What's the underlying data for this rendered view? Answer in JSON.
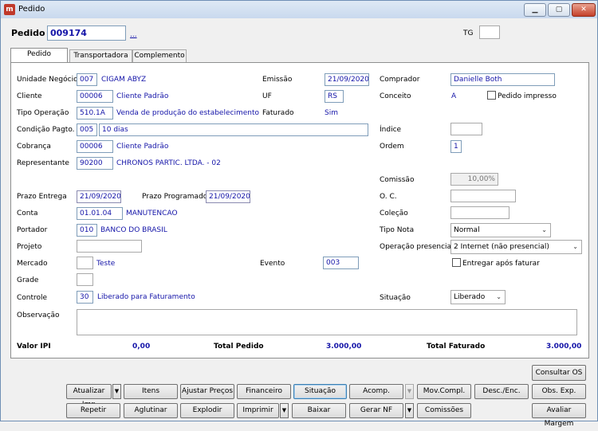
{
  "window": {
    "title": "Pedido",
    "min": "▁",
    "max": "▢",
    "close": "✕"
  },
  "header": {
    "pedido_label": "Pedido",
    "pedido_number": "009174",
    "lookup": "...",
    "tg_label": "TG",
    "tg_value": ""
  },
  "tabs": [
    {
      "label": "Pedido"
    },
    {
      "label": "Transportadora"
    },
    {
      "label": "Complemento"
    }
  ],
  "form": {
    "unidade": {
      "label": "Unidade Negócio",
      "code": "007",
      "name": "CIGAM ABYZ"
    },
    "emissao": {
      "label": "Emissão",
      "value": "21/09/2020"
    },
    "comprador": {
      "label": "Comprador",
      "value": "Danielle Both"
    },
    "cliente": {
      "label": "Cliente",
      "code": "00006",
      "name": "Cliente Padrão"
    },
    "uf": {
      "label": "UF",
      "value": "RS"
    },
    "conceito": {
      "label": "Conceito",
      "value": "A"
    },
    "pedido_impresso": {
      "label": "Pedido impresso"
    },
    "tipo_operacao": {
      "label": "Tipo Operação",
      "code": "510.1A",
      "name": "Venda de produção do estabelecimento"
    },
    "faturado": {
      "label": "Faturado",
      "value": "Sim"
    },
    "condicao": {
      "label": "Condição Pagto.",
      "code": "005",
      "name": "10 dias"
    },
    "indice": {
      "label": "Índice",
      "value": ""
    },
    "cobranca": {
      "label": "Cobrança",
      "code": "00006",
      "name": "Cliente Padrão"
    },
    "ordem": {
      "label": "Ordem",
      "value": "1"
    },
    "representante": {
      "label": "Representante",
      "code": "90200",
      "name": "CHRONOS PARTIC. LTDA. - 02"
    },
    "comissao": {
      "label": "Comissão",
      "value": "10,00%"
    },
    "prazo_entrega": {
      "label": "Prazo Entrega",
      "value": "21/09/2020"
    },
    "prazo_programado": {
      "label": "Prazo Programado",
      "value": "21/09/2020"
    },
    "oc": {
      "label": "O. C.",
      "value": ""
    },
    "conta": {
      "label": "Conta",
      "code": "01.01.04",
      "name": "MANUTENCAO"
    },
    "colecao": {
      "label": "Coleção",
      "value": ""
    },
    "portador": {
      "label": "Portador",
      "code": "010",
      "name": "BANCO DO BRASIL"
    },
    "tipo_nota": {
      "label": "Tipo Nota",
      "value": "Normal"
    },
    "projeto": {
      "label": "Projeto",
      "value": ""
    },
    "operacao_presencial": {
      "label": "Operação presencial",
      "value": "2 Internet (não presencial)"
    },
    "mercado": {
      "label": "Mercado",
      "code": "",
      "name": "Teste"
    },
    "evento": {
      "label": "Evento",
      "value": "003"
    },
    "entregar": {
      "label": "Entregar após faturar"
    },
    "grade": {
      "label": "Grade",
      "value": ""
    },
    "controle": {
      "label": "Controle",
      "code": "30",
      "name": "Liberado para Faturamento"
    },
    "situacao": {
      "label": "Situação",
      "value": "Liberado"
    },
    "observacao": {
      "label": "Observação",
      "value": ""
    }
  },
  "totals": {
    "ipi_label": "Valor IPI",
    "ipi_value": "0,00",
    "pedido_label": "Total Pedido",
    "pedido_value": "3.000,00",
    "faturado_label": "Total Faturado",
    "faturado_value": "3.000,00"
  },
  "buttons": {
    "consultar_os": "Consultar OS",
    "atualizar_imp": "Atualizar Imp",
    "itens": "Itens",
    "ajustar_precos": "Ajustar Preços",
    "financeiro": "Financeiro",
    "situacao": "Situação",
    "acomp": "Acomp.",
    "mov_compl": "Mov.Compl.",
    "desc_enc": "Desc./Enc.",
    "obs_exp": "Obs. Exp.",
    "repetir": "Repetir",
    "aglutinar": "Aglutinar",
    "explodir": "Explodir",
    "imprimir": "Imprimir",
    "baixar": "Baixar",
    "gerar_nf": "Gerar NF",
    "comissoes": "Comissões",
    "avaliar_margem": "Avaliar Margem"
  },
  "icons": {
    "dropdown": "▼"
  }
}
